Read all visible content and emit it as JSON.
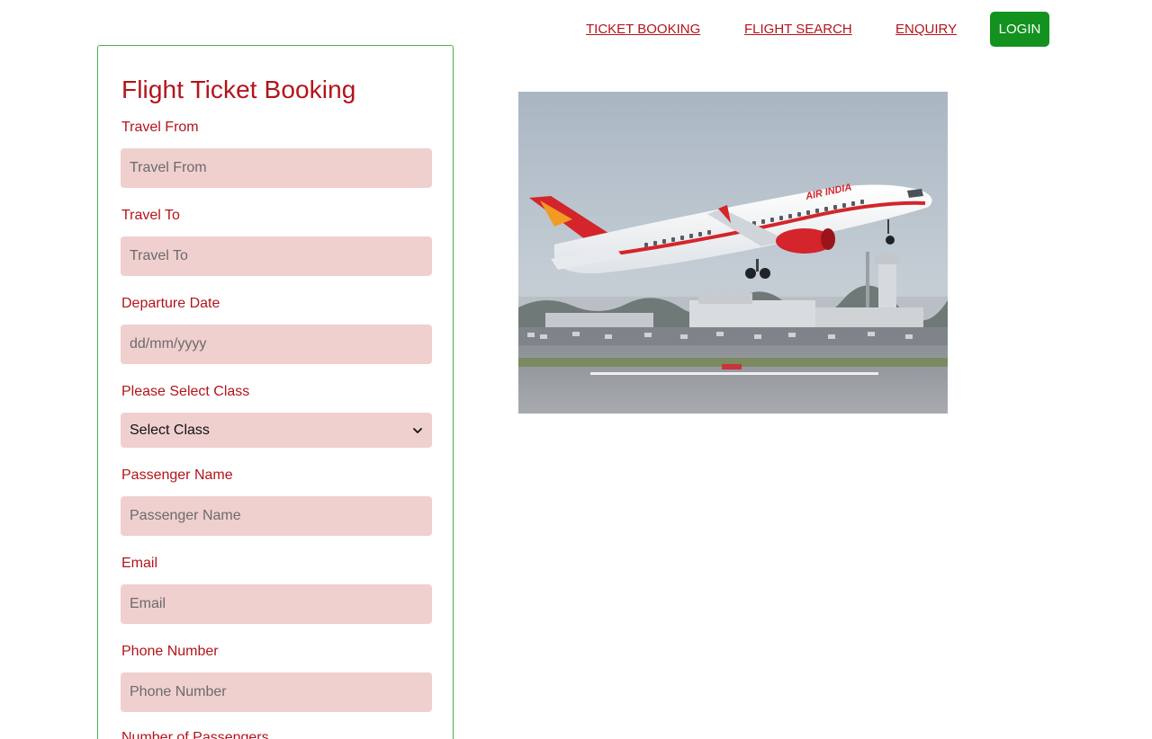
{
  "nav": {
    "links": [
      "TICKET BOOKING",
      "FLIGHT SEARCH",
      "ENQUIRY"
    ],
    "login_label": "LOGIN"
  },
  "form": {
    "title": "Flight Ticket Booking",
    "travel_from": {
      "label": "Travel From",
      "placeholder": "Travel From"
    },
    "travel_to": {
      "label": "Travel To",
      "placeholder": "Travel To"
    },
    "departure_date": {
      "label": "Departure Date",
      "placeholder": "dd/mm/yyyy"
    },
    "class": {
      "label": "Please Select Class",
      "selected": "Select Class"
    },
    "passenger_name": {
      "label": "Passenger Name",
      "placeholder": "Passenger Name"
    },
    "email": {
      "label": "Email",
      "placeholder": "Email"
    },
    "phone": {
      "label": "Phone Number",
      "placeholder": "Phone Number"
    },
    "passengers": {
      "label": "Number of Passengers"
    }
  },
  "photo": {
    "livery_text": "AIR INDIA"
  },
  "colors": {
    "accent_red": "#b3141b",
    "input_bg": "#f0cfcf",
    "login_green": "#13921f",
    "card_border": "#4caf50"
  }
}
